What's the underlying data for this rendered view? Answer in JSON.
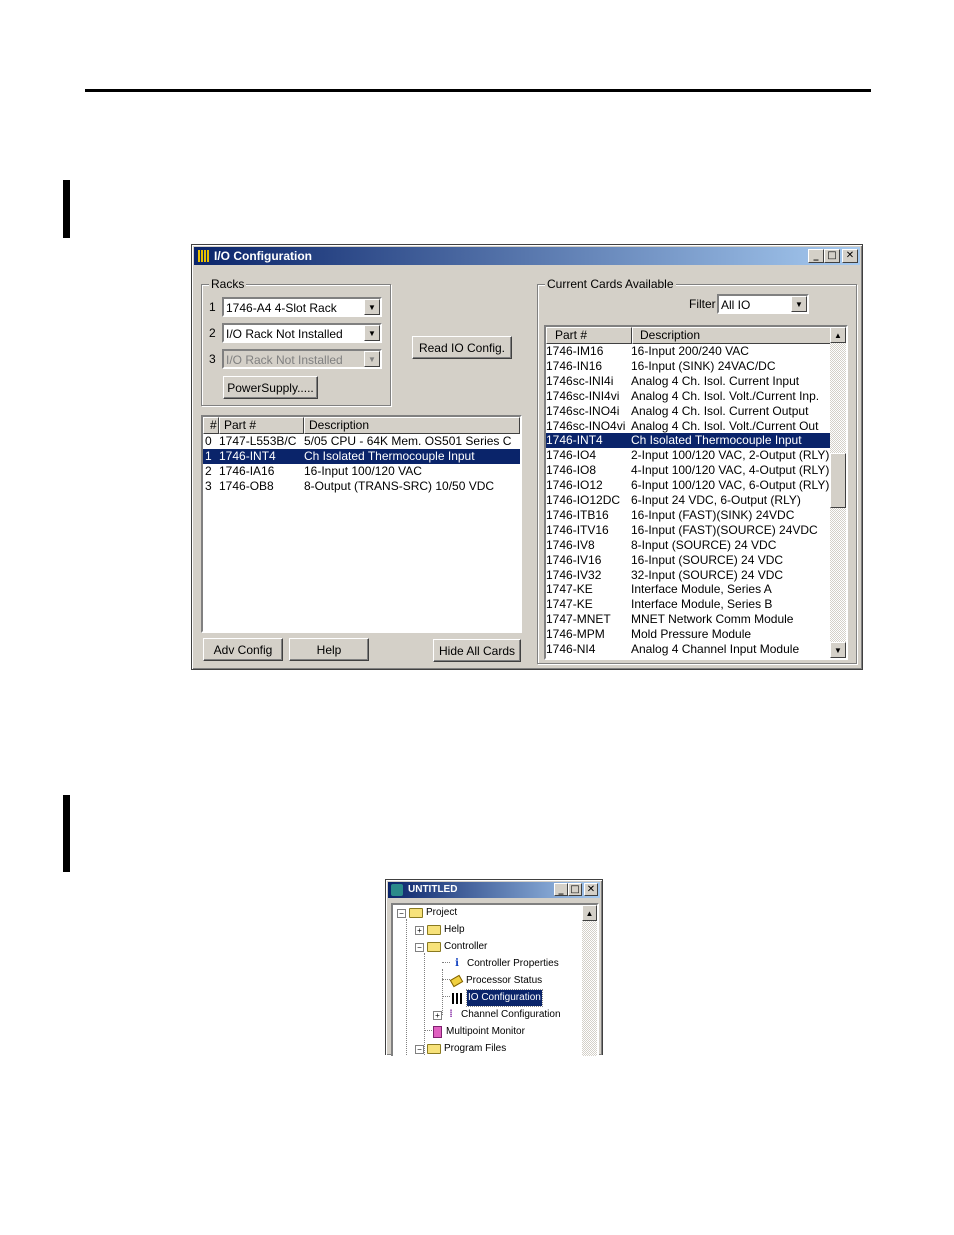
{
  "io_config": {
    "title": "I/O Configuration",
    "racks": {
      "group_label": "Racks",
      "rows": [
        {
          "num": "1",
          "value": "1746-A4  4-Slot Rack"
        },
        {
          "num": "2",
          "value": "I/O Rack Not Installed"
        },
        {
          "num": "3",
          "value": "I/O Rack Not Installed"
        }
      ],
      "power_supply_label": "PowerSupply....."
    },
    "read_io_label": "Read IO Config.",
    "slots": {
      "headers": [
        "#",
        "Part #",
        "Description"
      ],
      "rows": [
        {
          "num": "0",
          "part": "1747-L553B/C",
          "desc": "5/05 CPU - 64K Mem. OS501 Series C"
        },
        {
          "num": "1",
          "part": "1746-INT4",
          "desc": "Ch Isolated Thermocouple Input"
        },
        {
          "num": "2",
          "part": "1746-IA16",
          "desc": "16-Input 100/120 VAC"
        },
        {
          "num": "3",
          "part": "1746-OB8",
          "desc": " 8-Output (TRANS-SRC) 10/50 VDC"
        }
      ],
      "selected_index": 1
    },
    "buttons": {
      "adv_config": "Adv Config",
      "help": "Help",
      "hide_all_cards": "Hide All Cards"
    },
    "cards": {
      "group_label": "Current Cards Available",
      "filter_label": "Filter",
      "filter_value": "All IO",
      "headers": [
        "Part #",
        "Description"
      ],
      "rows": [
        {
          "part": "1746-IM16",
          "desc": "16-Input 200/240 VAC"
        },
        {
          "part": "1746-IN16",
          "desc": "16-Input (SINK) 24VAC/DC"
        },
        {
          "part": "1746sc-INI4i",
          "desc": "Analog 4 Ch. Isol. Current Input"
        },
        {
          "part": "1746sc-INI4vi",
          "desc": "Analog 4 Ch. Isol. Volt./Current Inp."
        },
        {
          "part": "1746sc-INO4i",
          "desc": "Analog 4 Ch. Isol. Current Output"
        },
        {
          "part": "1746sc-INO4vi",
          "desc": "Analog 4 Ch. Isol. Volt./Current Out"
        },
        {
          "part": "1746-INT4",
          "desc": "Ch Isolated Thermocouple Input"
        },
        {
          "part": "1746-IO4",
          "desc": " 2-Input 100/120 VAC, 2-Output (RLY)"
        },
        {
          "part": "1746-IO8",
          "desc": " 4-Input 100/120 VAC, 4-Output (RLY)"
        },
        {
          "part": "1746-IO12",
          "desc": " 6-Input 100/120 VAC, 6-Output (RLY)"
        },
        {
          "part": "1746-IO12DC",
          "desc": " 6-Input 24 VDC, 6-Output (RLY)"
        },
        {
          "part": "1746-ITB16",
          "desc": "16-Input (FAST)(SINK) 24VDC"
        },
        {
          "part": "1746-ITV16",
          "desc": "16-Input (FAST)(SOURCE) 24VDC"
        },
        {
          "part": "1746-IV8",
          "desc": " 8-Input (SOURCE) 24 VDC"
        },
        {
          "part": "1746-IV16",
          "desc": "16-Input (SOURCE) 24 VDC"
        },
        {
          "part": "1746-IV32",
          "desc": "32-Input (SOURCE) 24 VDC"
        },
        {
          "part": "1747-KE",
          "desc": "Interface Module, Series A"
        },
        {
          "part": "1747-KE",
          "desc": "Interface Module, Series B"
        },
        {
          "part": "1747-MNET",
          "desc": "MNET Network Comm Module"
        },
        {
          "part": "1746-MPM",
          "desc": "Mold Pressure Module"
        },
        {
          "part": "1746-NI4",
          "desc": "Analog  4 Channel Input Module"
        }
      ],
      "selected_index": 6
    }
  },
  "project_window": {
    "title": "UNTITLED",
    "tree": {
      "project": "Project",
      "help": "Help",
      "controller": "Controller",
      "controller_properties": "Controller Properties",
      "processor_status": "Processor Status",
      "io_configuration": "IO Configuration",
      "channel_configuration": "Channel Configuration",
      "multipoint_monitor": "Multipoint Monitor",
      "program_files": "Program Files"
    }
  }
}
